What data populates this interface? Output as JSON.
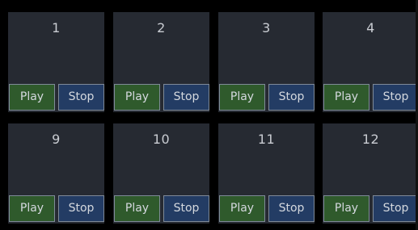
{
  "tiles": [
    {
      "label": "1",
      "play_label": "Play",
      "stop_label": "Stop"
    },
    {
      "label": "2",
      "play_label": "Play",
      "stop_label": "Stop"
    },
    {
      "label": "3",
      "play_label": "Play",
      "stop_label": "Stop"
    },
    {
      "label": "4",
      "play_label": "Play",
      "stop_label": "Stop"
    },
    {
      "label": "9",
      "play_label": "Play",
      "stop_label": "Stop"
    },
    {
      "label": "10",
      "play_label": "Play",
      "stop_label": "Stop"
    },
    {
      "label": "11",
      "play_label": "Play",
      "stop_label": "Stop"
    },
    {
      "label": "12",
      "play_label": "Play",
      "stop_label": "Stop"
    }
  ],
  "colors": {
    "background": "#000000",
    "tile": "#262a32",
    "play_button": "#2f5a2c",
    "stop_button": "#233c64",
    "button_border": "#7f8a98",
    "text": "#c9ccd2"
  }
}
